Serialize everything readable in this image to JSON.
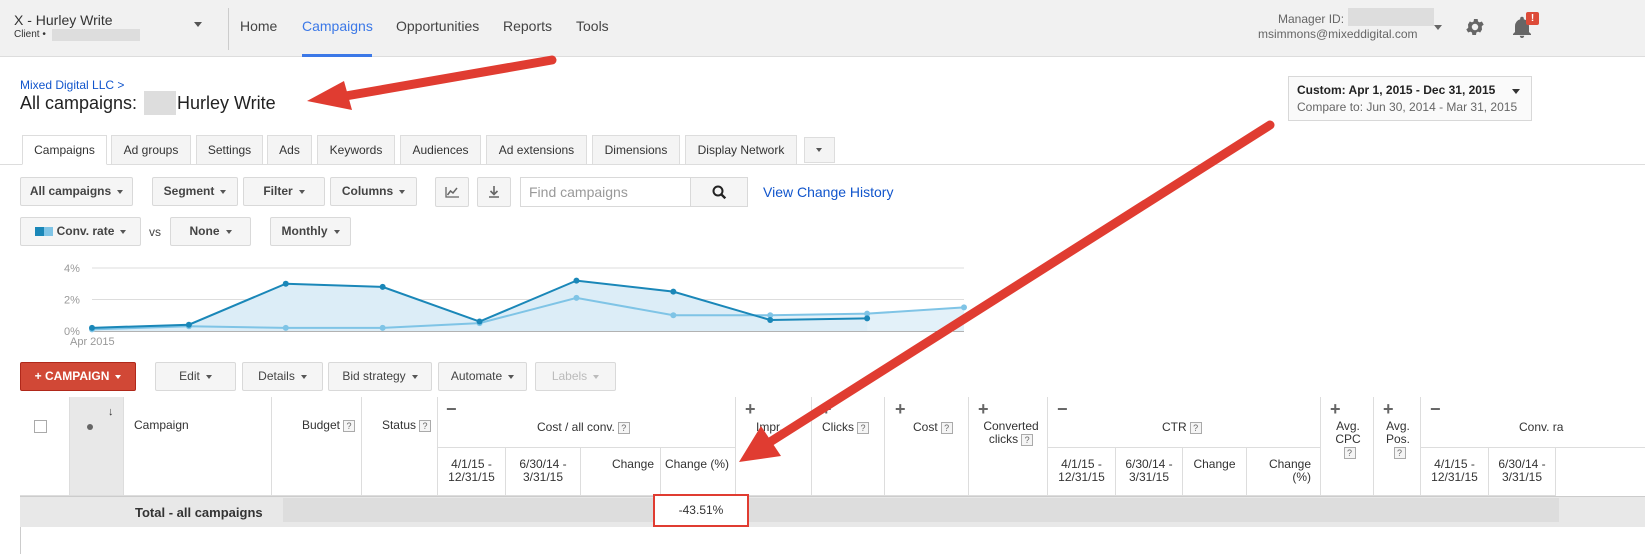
{
  "account": {
    "name": "X - Hurley Write",
    "client_label": "Client  •"
  },
  "nav": {
    "home": "Home",
    "campaigns": "Campaigns",
    "opportunities": "Opportunities",
    "reports": "Reports",
    "tools": "Tools"
  },
  "manager": {
    "label": "Manager ID:",
    "email": "msimmons@mixeddigital.com",
    "notification_badge": "!"
  },
  "breadcrumb": "Mixed Digital LLC >",
  "title": {
    "prefix": "All campaigns:",
    "name": "Hurley Write"
  },
  "date_range": {
    "main": "Custom: Apr 1, 2015 - Dec 31, 2015",
    "compare": "Compare to: Jun 30, 2014 - Mar 31, 2015"
  },
  "tabs": [
    "Campaigns",
    "Ad groups",
    "Settings",
    "Ads",
    "Keywords",
    "Audiences",
    "Ad extensions",
    "Dimensions",
    "Display Network"
  ],
  "toolbar": {
    "all_campaigns": "All campaigns",
    "segment": "Segment",
    "filter": "Filter",
    "columns": "Columns",
    "search_placeholder": "Find campaigns",
    "view_history": "View Change History"
  },
  "chart_controls": {
    "metric1": "Conv. rate",
    "vs": "vs",
    "metric2": "None",
    "period": "Monthly"
  },
  "chart_data": {
    "type": "line",
    "xlabel": "Apr 2015",
    "ylabel": "",
    "y_ticks": [
      "4%",
      "2%",
      "0%"
    ],
    "ylim": [
      0,
      4
    ],
    "grid": true,
    "series": [
      {
        "values": [
          0.2,
          0.4,
          3.0,
          2.8,
          0.6,
          3.2,
          2.5,
          0.7,
          0.8
        ],
        "color": "#1a87b8"
      },
      {
        "values": [
          0.1,
          0.3,
          0.2,
          0.2,
          0.5,
          2.1,
          1.0,
          1.0,
          1.1,
          1.5
        ],
        "color": "#7fc4e6"
      }
    ]
  },
  "action_bar": {
    "campaign": "CAMPAIGN",
    "edit": "Edit",
    "details": "Details",
    "bid_strategy": "Bid strategy",
    "automate": "Automate",
    "labels": "Labels"
  },
  "table": {
    "headers": {
      "campaign": "Campaign",
      "budget": "Budget",
      "status": "Status",
      "cost_conv": "Cost / all conv.",
      "impr": "Impr.",
      "clicks": "Clicks",
      "cost": "Cost",
      "converted_clicks": "Converted clicks",
      "ctr": "CTR",
      "avg_cpc": "Avg. CPC",
      "avg_pos": "Avg. Pos.",
      "conv_rate": "Conv. ra"
    },
    "subheaders": {
      "period1": "4/1/15 - 12/31/15",
      "period2": "6/30/14 - 3/31/15",
      "change": "Change",
      "change_pct": "Change (%)"
    },
    "total": {
      "label": "Total - all campaigns",
      "change_pct": "-43.51%"
    }
  }
}
